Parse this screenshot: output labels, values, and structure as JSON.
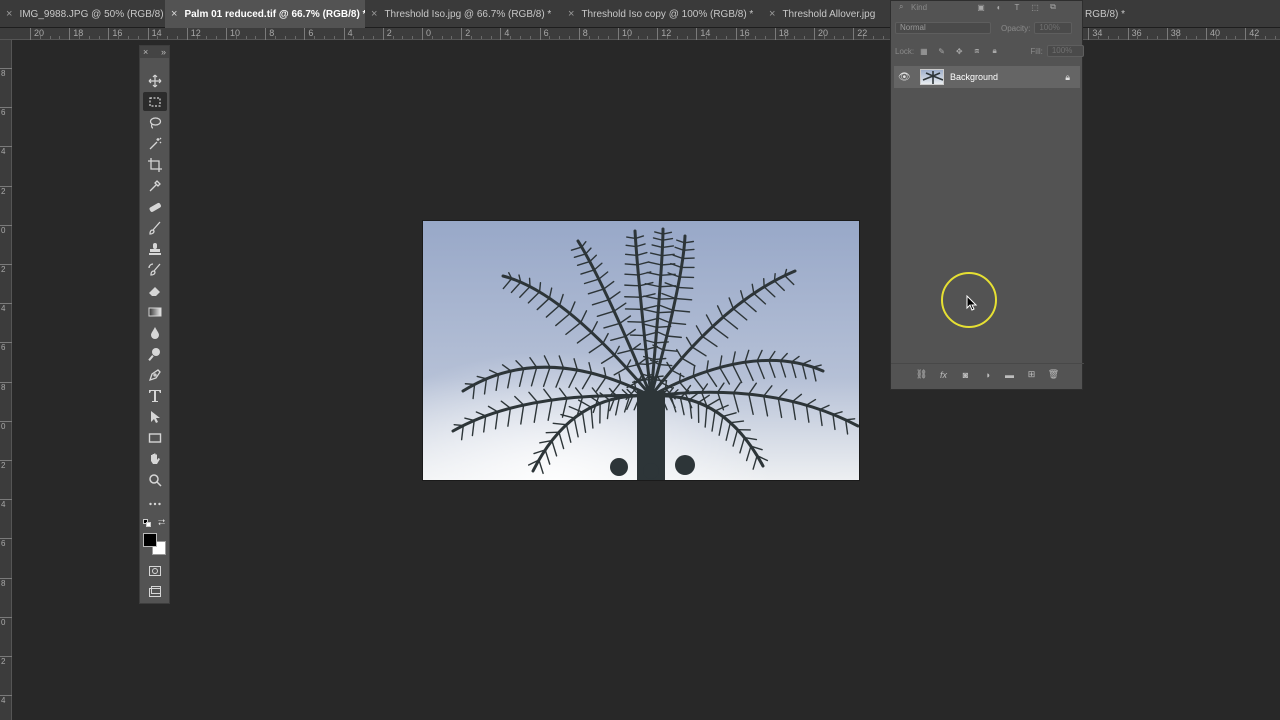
{
  "tabs": [
    {
      "label": "IMG_9988.JPG @ 50% (RGB/8)",
      "active": false
    },
    {
      "label": "Palm 01 reduced.tif @ 66.7% (RGB/8) *",
      "active": true
    },
    {
      "label": "Threshold Iso.jpg @ 66.7% (RGB/8) *",
      "active": false
    },
    {
      "label": "Threshold Iso copy @ 100% (RGB/8) *",
      "active": false
    },
    {
      "label": "Threshold Allover.jpg",
      "active": false
    },
    {
      "label": "RGB/8) *",
      "active": false
    }
  ],
  "ruler_top_labels": [
    "20",
    "18",
    "16",
    "14",
    "12",
    "10",
    "8",
    "6",
    "4",
    "2",
    "0",
    "2",
    "4",
    "6",
    "8",
    "10",
    "12",
    "14",
    "16",
    "18",
    "20",
    "22",
    "24",
    "26",
    "28",
    "30",
    "32",
    "34",
    "36",
    "38",
    "40",
    "42"
  ],
  "ruler_left_labels": [
    "8",
    "6",
    "4",
    "2",
    "0",
    "2",
    "4",
    "6",
    "8",
    "0",
    "2",
    "4",
    "6",
    "8",
    "0",
    "2",
    "4",
    "6"
  ],
  "toolbar": {
    "header_close": "×",
    "header_collapse": "»",
    "tools": [
      "move-icon",
      "rectangular-marquee-icon",
      "lasso-icon",
      "magic-wand-icon",
      "crop-icon",
      "eyedropper-icon",
      "healing-brush-icon",
      "brush-icon",
      "clone-stamp-icon",
      "history-brush-icon",
      "eraser-icon",
      "gradient-icon",
      "blur-icon",
      "dodge-icon",
      "pen-icon",
      "type-icon",
      "path-selection-icon",
      "rectangle-shape-icon",
      "hand-icon",
      "zoom-icon",
      "more-tools-icon"
    ],
    "selected_tool": "rectangular-marquee-icon",
    "foreground_color": "#000000",
    "background_color": "#ffffff"
  },
  "layers_panel": {
    "filter_label": "Kind",
    "blend_mode": "Normal",
    "opacity_label": "Opacity:",
    "opacity_value": "100%",
    "lock_label": "Lock:",
    "fill_label": "Fill:",
    "fill_value": "100%",
    "layers": [
      {
        "name": "Background",
        "visible": true,
        "locked": true
      }
    ]
  },
  "document": {
    "sky_top_color": "#98a8c8",
    "sky_bottom_color": "#eef0f2",
    "palm_color": "#2d3538"
  },
  "cursor_highlight_color": "#e6e033"
}
